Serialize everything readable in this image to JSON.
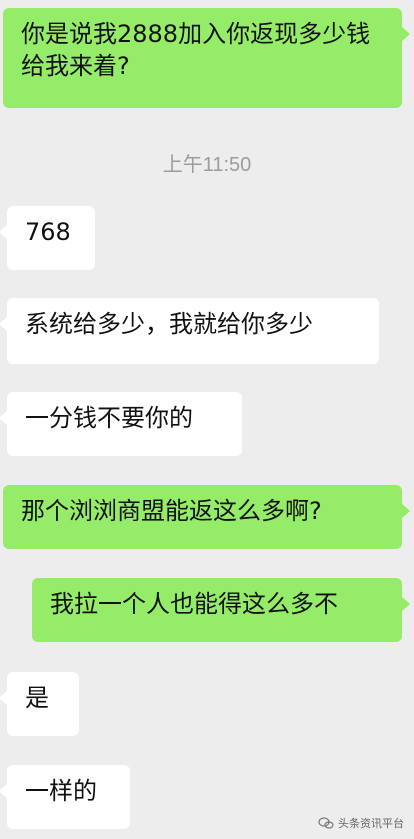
{
  "messages": [
    {
      "side": "sent",
      "text": "你是说我2888加入你返现多少钱给我来着?"
    },
    {
      "side": "received",
      "text": "768"
    },
    {
      "side": "received",
      "text": "系统给多少，我就给你多少"
    },
    {
      "side": "received",
      "text": "一分钱不要你的"
    },
    {
      "side": "sent",
      "text": "那个浏浏商盟能返这么多啊?"
    },
    {
      "side": "sent",
      "text": "我拉一个人也能得这么多不"
    },
    {
      "side": "received",
      "text": "是"
    },
    {
      "side": "received",
      "text": "一样的"
    }
  ],
  "timestamp": "上午11:50",
  "watermark": {
    "text": "头条资讯平台",
    "icon": "chat-logo-icon"
  },
  "colors": {
    "background": "#ededed",
    "sent_bubble": "#95ec69",
    "received_bubble": "#ffffff",
    "timestamp_text": "#9c9c9c"
  }
}
